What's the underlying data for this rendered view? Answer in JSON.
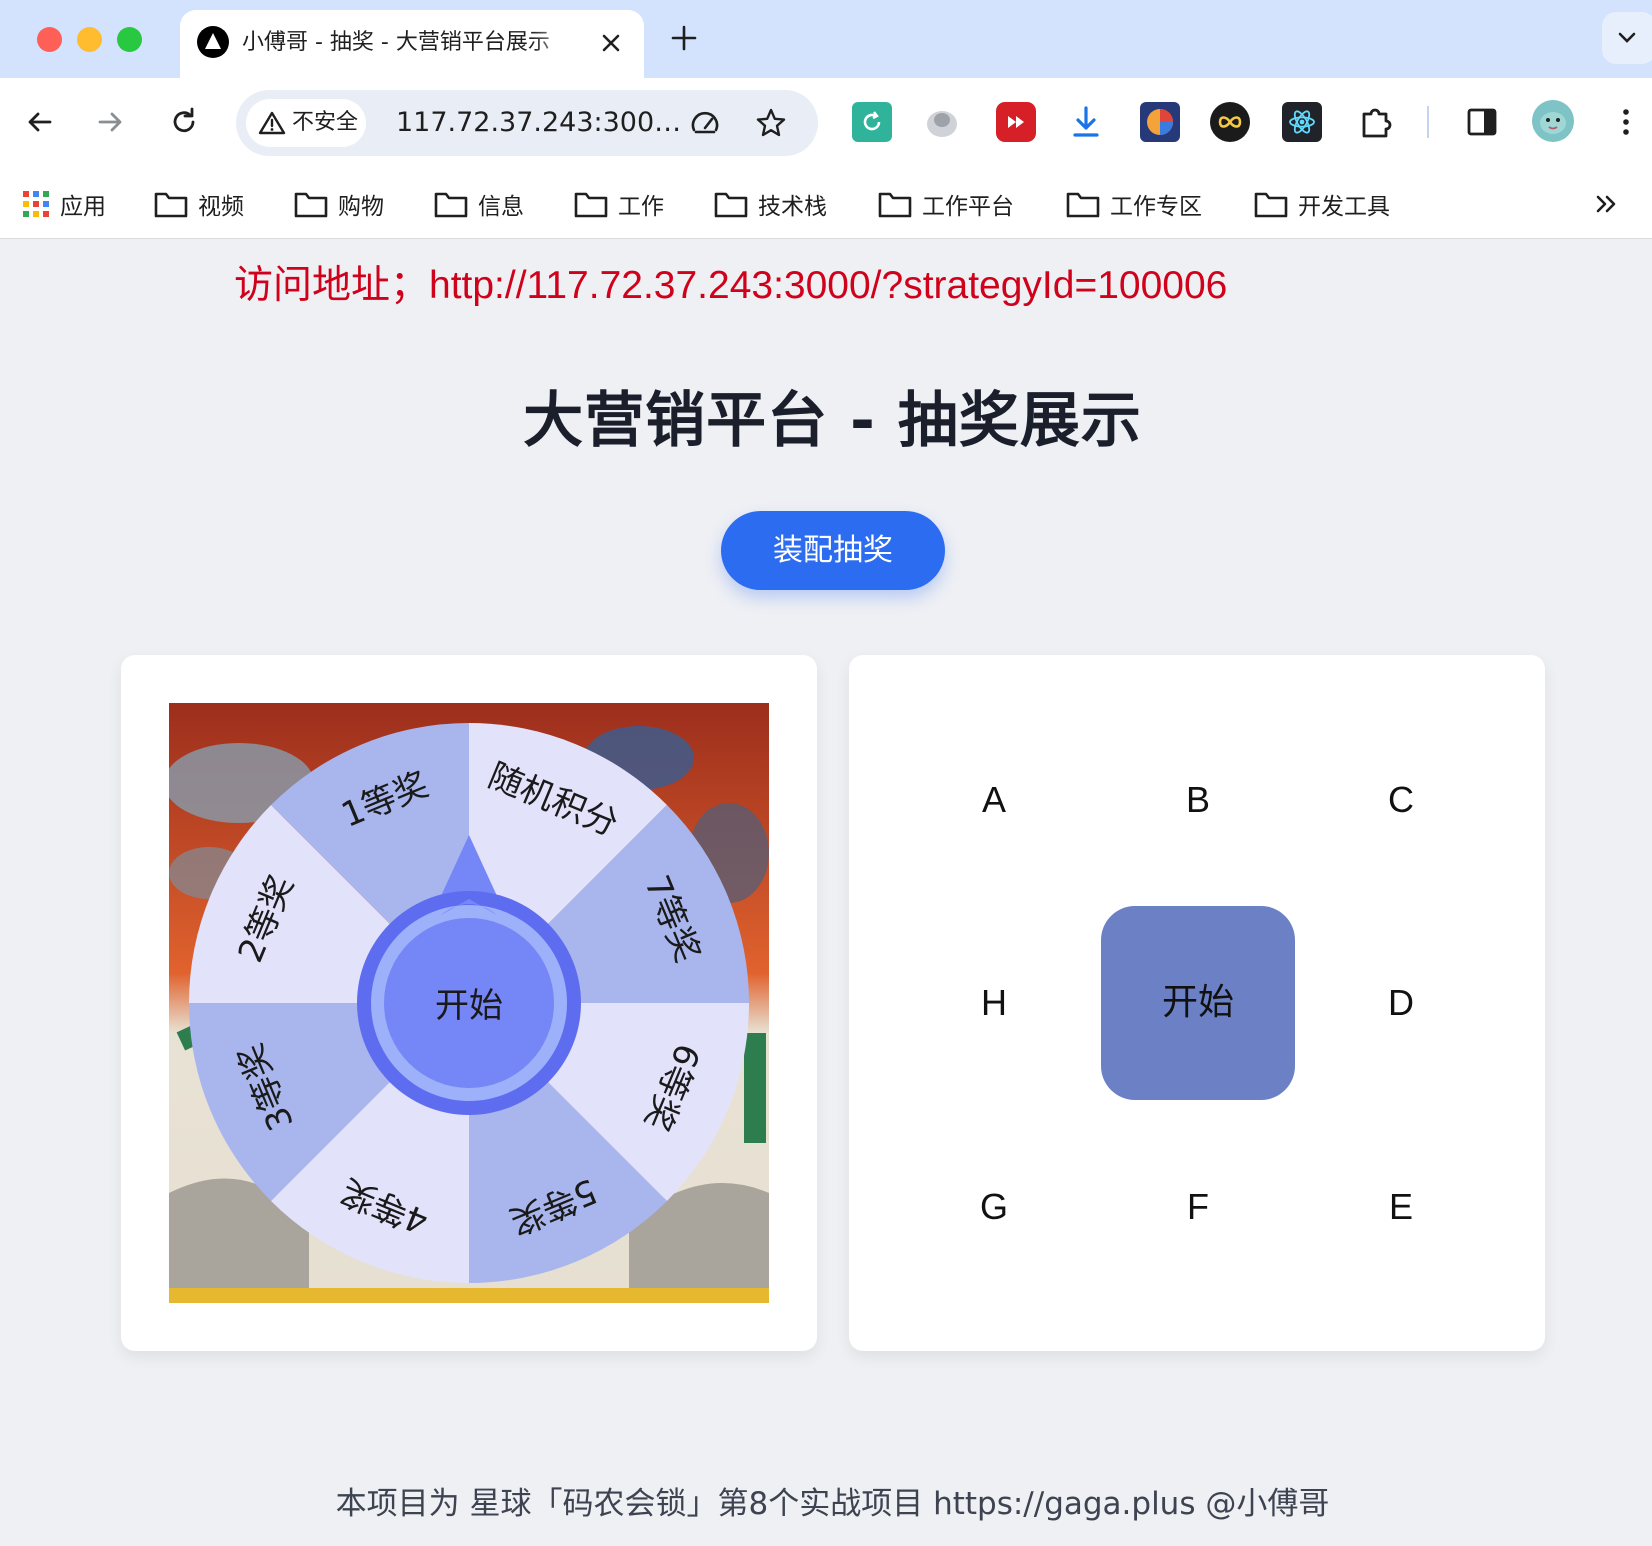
{
  "browser": {
    "tab_title": "小傅哥 - 抽奖 - 大营销平台展示",
    "security_label": "不安全",
    "url": "117.72.37.243:3000/?strategyId=100006",
    "bookmarks": [
      "应用",
      "视频",
      "购物",
      "信息",
      "工作",
      "技术栈",
      "工作平台",
      "工作专区",
      "开发工具"
    ]
  },
  "page": {
    "notice": "访问地址；http://117.72.37.243:3000/?strategyId=100006",
    "title": "大营销平台 - 抽奖展示",
    "assemble_button": "装配抽奖",
    "footer": "本项目为 星球「码农会锁」第8个实战项目 https://gaga.plus @小傅哥"
  },
  "wheel": {
    "start_label": "开始",
    "prizes": [
      "随机积分",
      "7等奖",
      "6等奖",
      "5等奖",
      "4等奖",
      "3等奖",
      "2等奖",
      "1等奖"
    ],
    "colors": {
      "light": "#e3e2fb",
      "dark": "#a9b6ed",
      "button_outer": "#5e6df0",
      "button_ring": "#9db0fa",
      "button_inner": "#7586f7"
    }
  },
  "grid": {
    "start_label": "开始",
    "cells": {
      "A": "A",
      "B": "B",
      "C": "C",
      "D": "D",
      "E": "E",
      "F": "F",
      "G": "G",
      "H": "H"
    },
    "start_color": "#6b80c5"
  },
  "colors": {
    "notice": "#d0021b",
    "accent": "#2c6cf0",
    "background": "#eff0f4"
  }
}
